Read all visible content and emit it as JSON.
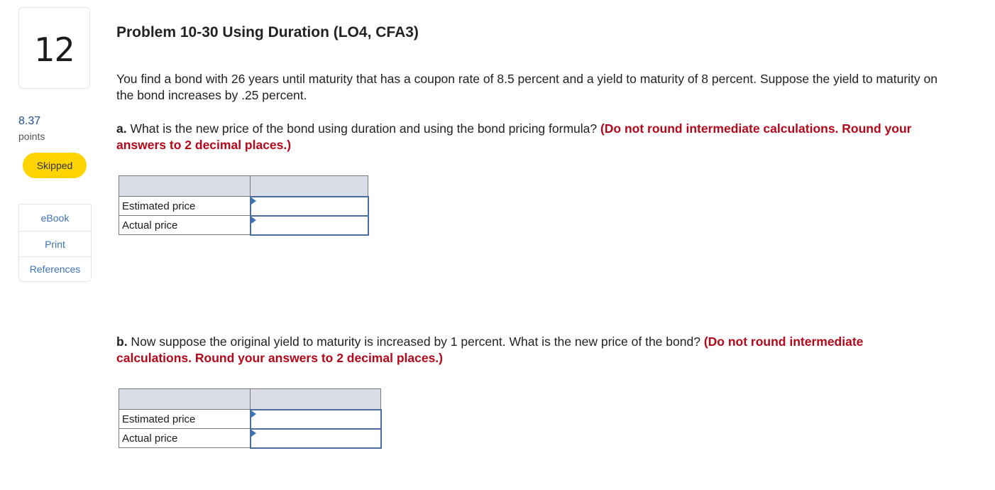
{
  "question": {
    "number": "12",
    "points_value": "8.37",
    "points_label": "points",
    "status": "Skipped",
    "status_color": "#ffd400"
  },
  "resources": [
    {
      "label": "eBook"
    },
    {
      "label": "Print"
    },
    {
      "label": "References"
    }
  ],
  "problem": {
    "title": "Problem 10-30 Using Duration (LO4, CFA3)",
    "intro": "You find a bond with 26 years until maturity that has a coupon rate of 8.5 percent and a yield to maturity of 8 percent. Suppose the yield to maturity on the bond increases by .25 percent."
  },
  "part_a": {
    "label": "a.",
    "question": " What is the new price of the bond using duration and using the bond pricing formula? ",
    "instruction": "(Do not round intermediate calculations. Round your answers to 2 decimal places.)",
    "rows": [
      {
        "label": "Estimated price",
        "value": ""
      },
      {
        "label": "Actual price",
        "value": ""
      }
    ]
  },
  "part_b": {
    "label": "b.",
    "question": " Now suppose the original yield to maturity is increased by 1 percent. What is the new price of the bond? ",
    "instruction": "(Do not round intermediate calculations. Round your answers to 2 decimal places.)",
    "rows": [
      {
        "label": "Estimated price",
        "value": ""
      },
      {
        "label": "Actual price",
        "value": ""
      }
    ]
  },
  "colors": {
    "accent_link": "#3d73b5",
    "instruction_red": "#b3081a",
    "table_header": "#d9dde8"
  }
}
